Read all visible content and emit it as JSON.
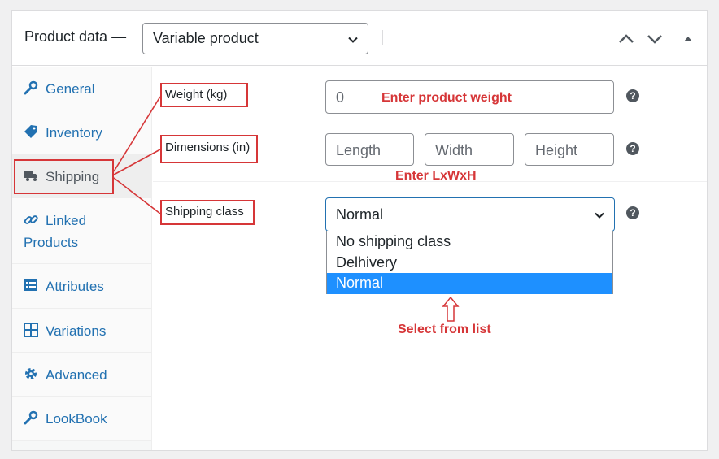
{
  "header": {
    "title": "Product data —",
    "product_type": "Variable product"
  },
  "sidebar": {
    "items": [
      {
        "label": "General",
        "icon": "wrench-icon"
      },
      {
        "label": "Inventory",
        "icon": "tag-icon"
      },
      {
        "label": "Shipping",
        "icon": "truck-icon"
      },
      {
        "label": "Linked",
        "label2": "Products",
        "icon": "link-icon"
      },
      {
        "label": "Attributes",
        "icon": "list-icon"
      },
      {
        "label": "Variations",
        "icon": "grid-icon"
      },
      {
        "label": "Advanced",
        "icon": "gear-icon"
      },
      {
        "label": "LookBook",
        "icon": "wrench-icon"
      }
    ],
    "active": "Shipping"
  },
  "fields": {
    "weight": {
      "label": "Weight (kg)",
      "placeholder": "0",
      "note": "Enter product weight"
    },
    "dimensions": {
      "label": "Dimensions (in)",
      "length": "Length",
      "width": "Width",
      "height": "Height",
      "note": "Enter LxWxH"
    },
    "shipping_class": {
      "label": "Shipping class",
      "value": "Normal",
      "options": [
        "No shipping class",
        "Delhivery",
        "Normal"
      ],
      "note": "Select from list"
    }
  },
  "help_icon": "?",
  "colors": {
    "accent": "#2271b1",
    "annotation": "#d63638",
    "selected_option": "#1e90ff"
  }
}
